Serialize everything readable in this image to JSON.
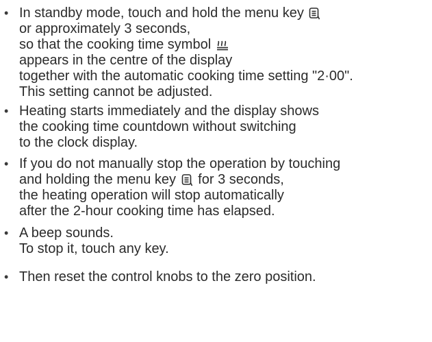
{
  "instructions": [
    {
      "lines": [
        {
          "pre": "In standby mode, touch and hold the menu key ",
          "icon": "menu-key-icon",
          "post": ""
        },
        {
          "text": "or approximately 3 seconds,"
        },
        {
          "pre": "so that the cooking time symbol ",
          "icon": "cooking-time-icon",
          "post": ""
        },
        {
          "text": "appears in the centre of the display"
        },
        {
          "text": "together with the automatic cooking time setting \"2·00\"."
        },
        {
          "text": "This setting cannot be adjusted."
        }
      ]
    },
    {
      "lines": [
        {
          "text": "Heating starts immediately and the display shows"
        },
        {
          "text": "the cooking time countdown without switching"
        },
        {
          "text": "to the clock display."
        }
      ]
    },
    {
      "lines": [
        {
          "text": "If you do not manually stop the operation by touching"
        },
        {
          "pre": "and holding the menu key ",
          "icon": "menu-key-icon",
          "post": " for 3 seconds,"
        },
        {
          "text": "the heating operation will stop automatically"
        },
        {
          "text": "after the 2-hour cooking time has elapsed."
        }
      ]
    },
    {
      "lines": [
        {
          "text": "A beep sounds."
        },
        {
          "text": "To stop it, touch any key."
        }
      ]
    },
    {
      "lines": [
        {
          "text": "Then reset the control knobs to the zero position."
        }
      ]
    }
  ]
}
